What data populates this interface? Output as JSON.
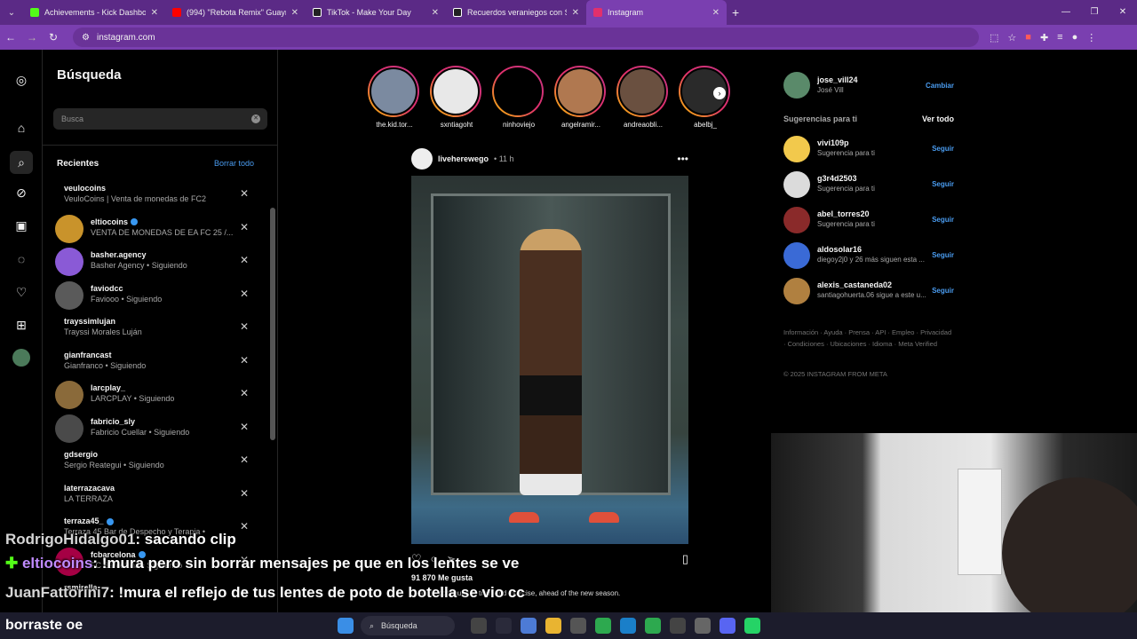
{
  "browser": {
    "tabs": [
      {
        "title": "Achievements - Kick Dashboard",
        "color": "#53fc18"
      },
      {
        "title": "(994) \"Rebota Remix\" Guaynaa",
        "color": "#ff0000"
      },
      {
        "title": "TikTok - Make Your Day",
        "color": "#111111"
      },
      {
        "title": "Recuerdos veraniegos con Suy",
        "color": "#111111"
      },
      {
        "title": "Instagram",
        "color": "#e1306c"
      }
    ],
    "url": "instagram.com"
  },
  "search": {
    "title": "Búsqueda",
    "placeholder": "Busca",
    "recents_label": "Recientes",
    "clear_all": "Borrar todo",
    "recents": [
      {
        "username": "veulocoins",
        "sub": "VeuloCoins | Venta de monedas de FC25. • ...",
        "verified": false,
        "avatar": ""
      },
      {
        "username": "eltiocoins",
        "sub": "VENTA DE MONEDAS DE EA FC 25 /...",
        "verified": true,
        "avatar": "#c9932b"
      },
      {
        "username": "basher.agency",
        "sub": "Basher Agency • Siguiendo",
        "verified": false,
        "avatar": "#8a5ad6"
      },
      {
        "username": "faviodcc",
        "sub": "Faviooo • Siguiendo",
        "verified": false,
        "avatar": "#5a5a5a"
      },
      {
        "username": "trayssimlujan",
        "sub": "Trayssi Morales Luján",
        "verified": false,
        "avatar": ""
      },
      {
        "username": "gianfrancast",
        "sub": "Gianfranco • Siguiendo",
        "verified": false,
        "avatar": ""
      },
      {
        "username": "larcplay_",
        "sub": "LARCPLAY • Siguiendo",
        "verified": false,
        "avatar": "#8a6a3a"
      },
      {
        "username": "fabricio_sly",
        "sub": "Fabricio Cuellar • Siguiendo",
        "verified": false,
        "avatar": "#4a4a4a"
      },
      {
        "username": "gdsergio",
        "sub": "Sergio Reategui • Siguiendo",
        "verified": false,
        "avatar": ""
      },
      {
        "username": "laterrazacava",
        "sub": "LA TERRAZA",
        "verified": false,
        "avatar": ""
      },
      {
        "username": "terraza45_",
        "sub": "Terraza 45 Bar de Despecho y Terapia • 64...",
        "verified": true,
        "avatar": ""
      },
      {
        "username": "fcbarcelona",
        "sub": "FC Barcelona • Siguiendo",
        "verified": true,
        "avatar": "#a50044"
      },
      {
        "username": "rsmirella",
        "sub": "",
        "verified": false,
        "avatar": ""
      }
    ]
  },
  "stories": [
    {
      "name": "the.kid.tor...",
      "color": "#7b8aa0"
    },
    {
      "name": "sxntiagoht",
      "color": "#e8e8e8"
    },
    {
      "name": "ninhoviejo",
      "color": "#000000"
    },
    {
      "name": "angelramir...",
      "color": "#b07850"
    },
    {
      "name": "andreaobli...",
      "color": "#6a5040"
    },
    {
      "name": "abelbj_",
      "color": "#2a2a2a"
    }
  ],
  "post": {
    "username": "liveherewego",
    "time": "11 h",
    "likes": "91 870 Me gusta",
    "caption": "... as he continues to train and exercise, ahead of the new season."
  },
  "me": {
    "username": "jose_vill24",
    "name": "José Vill",
    "switch": "Cambiar"
  },
  "suggestions_header": {
    "title": "Sugerencias para ti",
    "see_all": "Ver todo"
  },
  "suggestions": [
    {
      "username": "vivi109p",
      "sub": "Sugerencia para ti",
      "action": "Seguir",
      "avatar": "#f2c94c"
    },
    {
      "username": "g3r4d2503",
      "sub": "Sugerencia para ti",
      "action": "Seguir",
      "avatar": "#dbdbdb"
    },
    {
      "username": "abel_torres20",
      "sub": "Sugerencia para ti",
      "action": "Seguir",
      "avatar": "#8a2a2a"
    },
    {
      "username": "aldosolar16",
      "sub": "diegoy2j0 y 26 más siguen esta ...",
      "action": "Seguir",
      "avatar": "#3a6ad6"
    },
    {
      "username": "alexis_castaneda02",
      "sub": "santiagohuerta.06 sigue a este u...",
      "action": "Seguir",
      "avatar": "#b08040"
    }
  ],
  "footer": {
    "links": "Información · Ayuda · Prensa · API · Empleo · Privacidad · Condiciones · Ubicaciones · Idioma · Meta Verified",
    "copyright": "© 2025 INSTAGRAM FROM META"
  },
  "chat": [
    {
      "name": "RodrigoHidalgo01",
      "msg": ": sacando clip"
    },
    {
      "name": "eltiocoins",
      "msg": ": !mura pero sin borrar mensajes pe que en los lentes se ve"
    },
    {
      "name": "JuanFattorini7",
      "msg": ": !mura el reflejo de tus lentes de poto de botella se vio cc"
    },
    {
      "name": "",
      "msg": "borraste oe"
    }
  ],
  "taskbar": {
    "search": "Búsqueda"
  }
}
